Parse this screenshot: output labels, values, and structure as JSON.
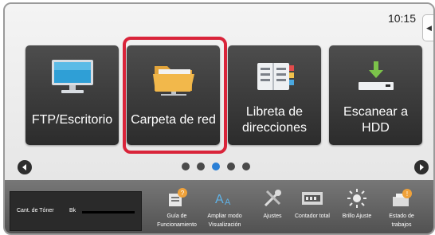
{
  "status": {
    "time": "10:15",
    "side_tab_icon": "arrow-left-icon"
  },
  "tiles": [
    {
      "label": "FTP/Escritorio",
      "icon": "monitor-icon"
    },
    {
      "label": "Carpeta de red",
      "icon": "folder-icon",
      "highlighted": true
    },
    {
      "label": "Libreta de direcciones",
      "icon": "address-book-icon"
    },
    {
      "label": "Escanear a HDD",
      "icon": "download-to-hdd-icon"
    }
  ],
  "pager": {
    "pages": 5,
    "active_page": 3
  },
  "toner": {
    "label": "Cant. de Tóner",
    "color_code": "Bk"
  },
  "shortcuts": [
    {
      "label": "Guía de Funcionamiento",
      "icon": "help-book-icon"
    },
    {
      "label": "Ampliar modo Visualización",
      "icon": "text-zoom-icon"
    },
    {
      "label": "Ajustes",
      "icon": "tools-icon"
    },
    {
      "label": "Contador total",
      "icon": "counter-icon"
    },
    {
      "label": "Brillo Ajuste",
      "icon": "brightness-icon"
    },
    {
      "label": "Estado de trabajos",
      "icon": "job-status-icon"
    }
  ],
  "colors": {
    "highlight": "#d9243a",
    "active_dot": "#2a7fd6",
    "tile_bg": "#3a3a3a"
  }
}
